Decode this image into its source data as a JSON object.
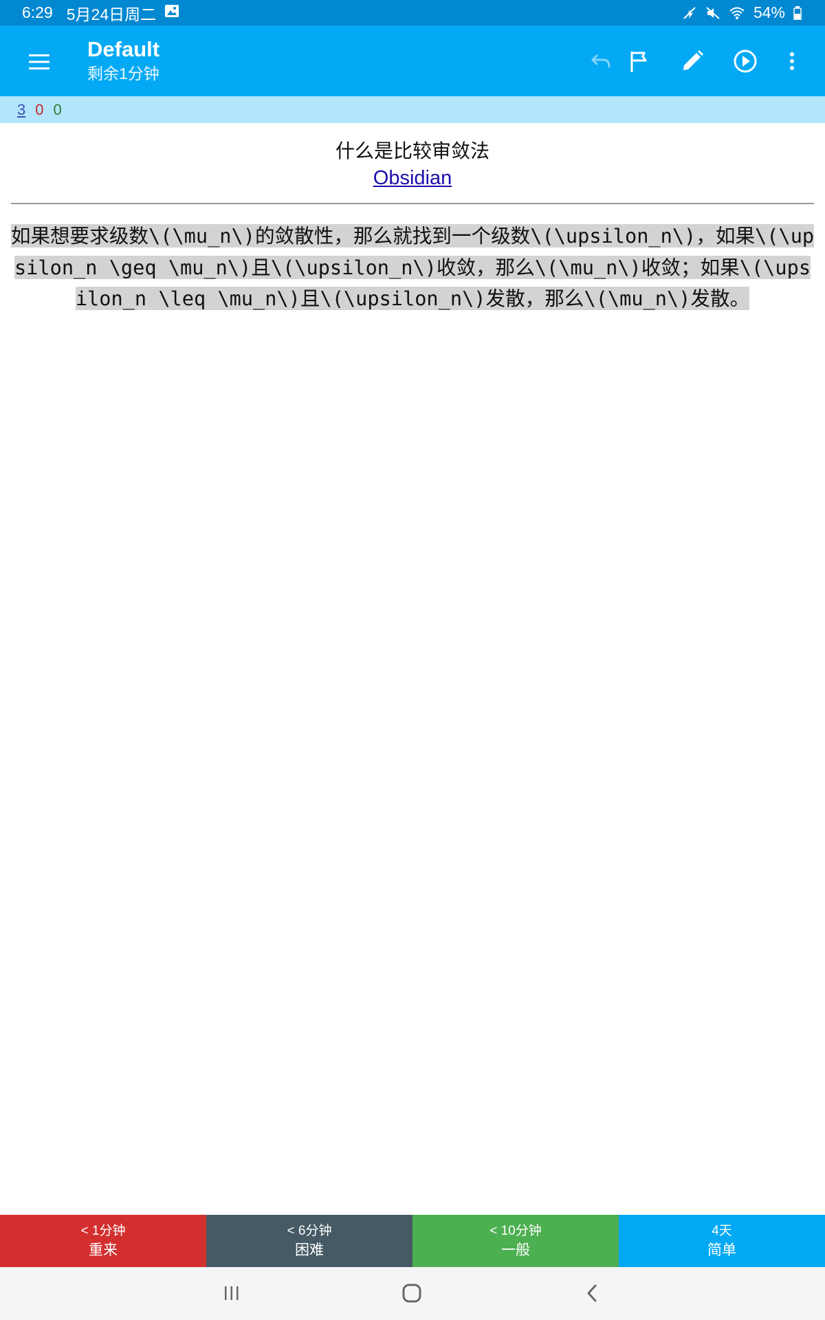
{
  "status_bar": {
    "time": "6:29",
    "date": "5月24日周二",
    "battery": "54%"
  },
  "app_bar": {
    "title": "Default",
    "subtitle": "剩余1分钟"
  },
  "counts": {
    "new": "3",
    "learn": "0",
    "review": "0"
  },
  "card": {
    "question": "什么是比较审敛法",
    "source_link": "Obsidian",
    "answer": "如果想要求级数\\(\\mu_n\\)的敛散性，那么就找到一个级数\\(\\upsilon_n\\)，如果\\(\\upsilon_n \\geq \\mu_n\\)且\\(\\upsilon_n\\)收敛，那么\\(\\mu_n\\)收敛；如果\\(\\upsilon_n \\leq \\mu_n\\)且\\(\\upsilon_n\\)发散，那么\\(\\mu_n\\)发散。"
  },
  "answer_buttons": [
    {
      "interval": "< 1分钟",
      "label": "重来"
    },
    {
      "interval": "< 6分钟",
      "label": "困难"
    },
    {
      "interval": "< 10分钟",
      "label": "一般"
    },
    {
      "interval": "4天",
      "label": "简单"
    }
  ],
  "colors": {
    "app_bar": "#03a9f4",
    "status_bar": "#0288d1",
    "again": "#d32f2f",
    "hard": "#455a64",
    "good": "#4caf50",
    "easy": "#03a9f4"
  }
}
